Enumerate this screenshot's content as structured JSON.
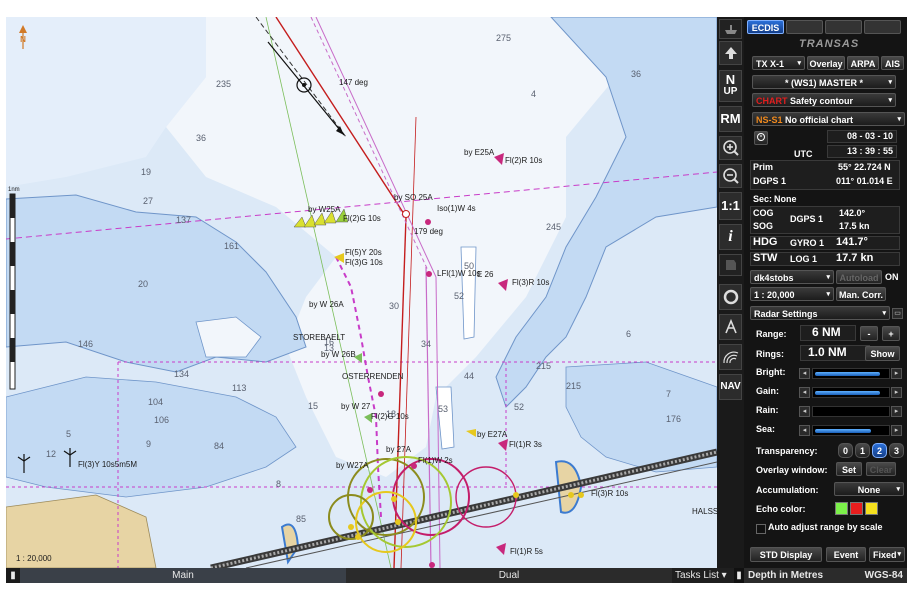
{
  "chart": {
    "north_label": "N",
    "scale_label": "1 : 20,000",
    "scale_bar_label": "1nm",
    "depths": [
      "235",
      "36",
      "275",
      "19",
      "4",
      "36",
      "137",
      "27",
      "161",
      "245",
      "20",
      "146",
      "16",
      "13",
      "134",
      "104",
      "113",
      "44",
      "15",
      "84",
      "215",
      "106",
      "6",
      "7",
      "9",
      "8",
      "5",
      "18",
      "50",
      "30",
      "52",
      "53",
      "52",
      "34",
      "85",
      "12",
      "176",
      "215"
    ],
    "labels": [
      {
        "t": "147 deg"
      },
      {
        "t": "by E25A"
      },
      {
        "t": "Fl(2)R 10s"
      },
      {
        "t": "by SO 25A"
      },
      {
        "t": "Iso(1)W 4s"
      },
      {
        "t": "179 deg"
      },
      {
        "t": "by W25A"
      },
      {
        "t": "Fl(2)G 10s"
      },
      {
        "t": "Fl(5)Y 20s"
      },
      {
        "t": "Fl(3)G 10s"
      },
      {
        "t": "LFl(1)W 10s"
      },
      {
        "t": "E 26"
      },
      {
        "t": "Fl(3)R 10s"
      },
      {
        "t": "by W 26A"
      },
      {
        "t": "STOREBAELT"
      },
      {
        "t": "by W 26B"
      },
      {
        "t": "OSTERRENDEN"
      },
      {
        "t": "by W 27"
      },
      {
        "t": "Fl(2)G 10s"
      },
      {
        "t": "by E27A"
      },
      {
        "t": "Fl(1)R 3s"
      },
      {
        "t": "by 27A"
      },
      {
        "t": "Fl(1)W 2s"
      },
      {
        "t": "by W27A"
      },
      {
        "t": "Fl(3)Y 10s5m5M"
      },
      {
        "t": "Fl(1)R 5s"
      },
      {
        "t": "HALSS REV"
      },
      {
        "t": "Fl(3)R 10s"
      }
    ]
  },
  "bottom": {
    "main": "Main",
    "dual": "Dual",
    "tasks": "Tasks List",
    "depth": "Depth in Metres",
    "datum": "WGS-84"
  },
  "icons": [
    "ship-icon",
    "n-up-icon",
    "rm-icon",
    "zoom-in-icon",
    "zoom-out-icon",
    "one-to-one-icon",
    "info-icon",
    "layers-icon",
    "ring-icon",
    "compass-icon",
    "radar-icon",
    "nav-icon"
  ],
  "iconlabels": {
    "nup1": "N",
    "nup2": "UP",
    "rm": "RM",
    "one": "1:1",
    "info": "i",
    "nav": "NAV"
  },
  "panel": {
    "tabs": [
      "ECDIS",
      "",
      "",
      ""
    ],
    "brand": "TRANSAS",
    "txsel": "TX X-1",
    "overlay": "Overlay",
    "arpa": "ARPA",
    "ais": "AIS",
    "master": "* (WS1) MASTER *",
    "chart_tag": "CHART",
    "chart_val": "Safety contour",
    "ns_tag": "NS-S1",
    "ns_val": "No official chart",
    "date": "08 - 03 - 10",
    "utc": "UTC",
    "time": "13 : 39 : 55",
    "prim": "Prim",
    "lat": "55° 22.724 N",
    "dgps": "DGPS 1",
    "lon": "011° 01.014 E",
    "sec": "Sec:",
    "sec_val": "None",
    "cog": "COG",
    "sog": "SOG",
    "dgps1": "DGPS 1",
    "cog_val": "142.0°",
    "sog_val": "17.5 kn",
    "hdg": "HDG",
    "gyro": "GYRO 1",
    "hdg_val": "141.7°",
    "stw": "STW",
    "log": "LOG 1",
    "stw_val": "17.7 kn",
    "dk": "dk4stobs",
    "autoload": "Autoload",
    "on": "ON",
    "scale": "1 : 20,000",
    "man": "Man. Corr.",
    "radar": "Radar Settings",
    "range_lbl": "Range:",
    "range_val": "6 NM",
    "minus": "-",
    "plus": "+",
    "rings_lbl": "Rings:",
    "rings_val": "1.0 NM",
    "show": "Show",
    "bright": "Bright:",
    "gain": "Gain:",
    "rain": "Rain:",
    "sea": "Sea:",
    "bright_level": 0.93,
    "gain_level": 0.93,
    "rain_level": 0,
    "sea_level": 0.8,
    "transp": "Transparency:",
    "t0": "0",
    "t1": "1",
    "t2": "2",
    "t3": "3",
    "ovw": "Overlay window:",
    "set": "Set",
    "clear": "Clear",
    "accum": "Accumulation:",
    "accum_val": "None",
    "echo": "Echo color:",
    "echo_colors": [
      "#7cf04a",
      "#e81e1e",
      "#f5e01e"
    ],
    "auto": "Auto adjust range by scale",
    "std": "STD Display",
    "event": "Event",
    "fixed": "Fixed"
  }
}
